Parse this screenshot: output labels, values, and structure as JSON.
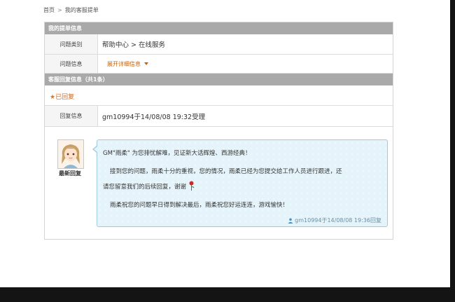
{
  "breadcrumb": {
    "home": "首页",
    "separator": ">",
    "current": "我的客服提单"
  },
  "ticket_section": {
    "title": "我的提单信息",
    "rows": [
      {
        "label": "问题类别",
        "value": "帮助中心 > 在线服务"
      },
      {
        "label": "问题信息",
        "value": "展开详细信息"
      }
    ]
  },
  "reply_section": {
    "title": "客服回复信息（共1条）",
    "status_star": "★",
    "status": "已回复",
    "reply_info": {
      "label": "回复信息",
      "value": "gm10994于14/08/08 19:32受理"
    }
  },
  "message": {
    "avatar_label": "最新回复",
    "line1": "GM\"雨柔\" 为您排忧解难，见证新大话辉煌、西游经典！",
    "line2a": "接到您的问题，雨柔十分的重视，您的情况，雨柔已经为您提交给工作人员进行跟进，还",
    "line2b": "请您留意我们的后续回复，谢谢",
    "line3": "雨柔祝您的问题早日得到解决最后，雨柔祝您好运连连，游戏愉快！",
    "signature": "gm10994于14/08/08 19:36回复"
  },
  "colors": {
    "section_header": "#a9a9a9",
    "accent_orange": "#c8620a",
    "bubble_bg": "#e5f4fb",
    "bubble_border": "#9fcbe0",
    "frame_dark": "#141414"
  }
}
